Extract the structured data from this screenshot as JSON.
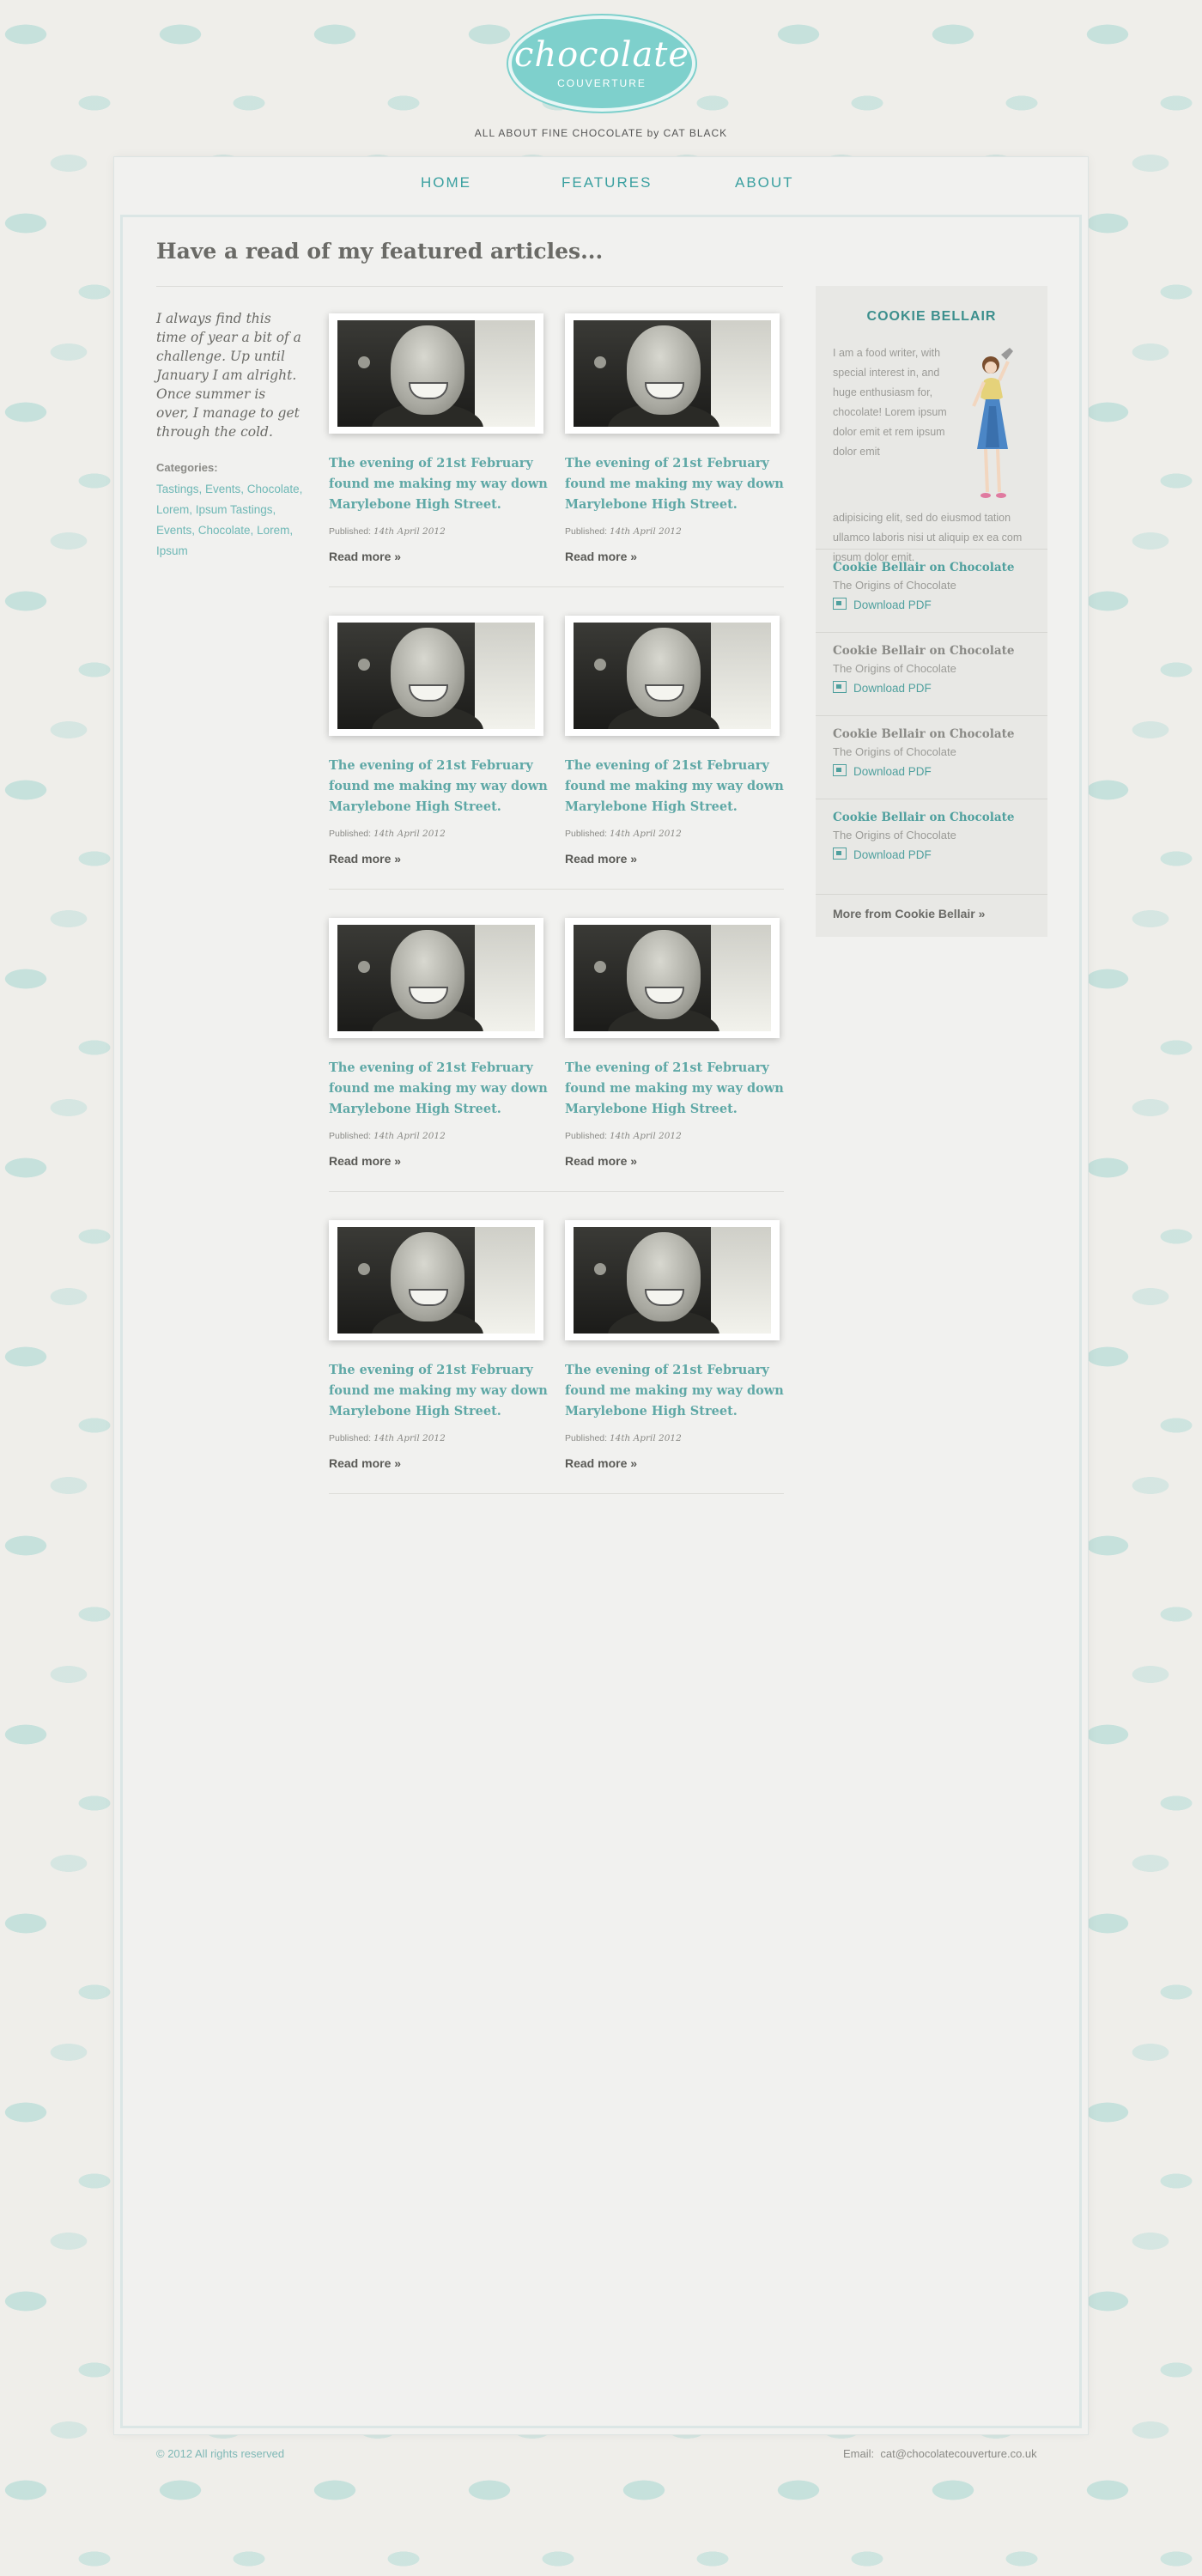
{
  "brand": {
    "logo_script": "chocolate",
    "logo_sub": "COUVERTURE",
    "tagline": "ALL ABOUT FINE CHOCOLATE by CAT BLACK"
  },
  "nav": [
    "HOME",
    "FEATURES",
    "ABOUT"
  ],
  "main": {
    "headline": "Have a read of my featured articles...",
    "intro": "I always find this time of year a bit of a challenge. Up until January I am alright. Once summer is over, I manage to get through the cold.",
    "categories_label": "Categories:",
    "categories": "Tastings, Events, Chocolate, Lorem, Ipsum Tastings, Events, Chocolate, Lorem, Ipsum",
    "articles": [
      {
        "title": "The evening of 21st February found me making my way down Marylebone High Street.",
        "published_label": "Published:",
        "date": "14th April 2012",
        "read_more": "Read more »"
      },
      {
        "title": "The evening of 21st February found me making my way down Marylebone High Street.",
        "published_label": "Published:",
        "date": "14th April 2012",
        "read_more": "Read more »"
      },
      {
        "title": "The evening of 21st February found me making my way down Marylebone High Street.",
        "published_label": "Published:",
        "date": "14th April 2012",
        "read_more": "Read more »"
      },
      {
        "title": "The evening of 21st February found me making my way down Marylebone High Street.",
        "published_label": "Published:",
        "date": "14th April 2012",
        "read_more": "Read more »"
      },
      {
        "title": "The evening of 21st February found me making my way down Marylebone High Street.",
        "published_label": "Published:",
        "date": "14th April 2012",
        "read_more": "Read more »"
      },
      {
        "title": "The evening of 21st February found me making my way down Marylebone High Street.",
        "published_label": "Published:",
        "date": "14th April 2012",
        "read_more": "Read more »"
      },
      {
        "title": "The evening of 21st February found me making my way down Marylebone High Street.",
        "published_label": "Published:",
        "date": "14th April 2012",
        "read_more": "Read more »"
      },
      {
        "title": "The evening of 21st February found me making my way down Marylebone High Street.",
        "published_label": "Published:",
        "date": "14th April 2012",
        "read_more": "Read more »"
      }
    ]
  },
  "sidebar": {
    "title": "COOKIE BELLAIR",
    "bio": "I am a food writer, with special interest in, and huge enthusiasm for, chocolate! Lorem ipsum dolor emit et rem ipsum dolor emit",
    "bio_cont": "adipisicing elit, sed do eiusmod tation ullamco laboris nisi ut aliquip ex ea com ipsum dolor emit.",
    "items": [
      {
        "title": "Cookie Bellair on Chocolate",
        "sub": "The Origins of Chocolate",
        "download": "Download PDF",
        "color": "#4fa09e"
      },
      {
        "title": "Cookie Bellair on Chocolate",
        "sub": "The Origins of Chocolate",
        "download": "Download PDF",
        "color": "#8a8a86"
      },
      {
        "title": "Cookie Bellair on Chocolate",
        "sub": "The Origins of Chocolate",
        "download": "Download PDF",
        "color": "#8a8a86"
      },
      {
        "title": "Cookie Bellair on Chocolate",
        "sub": "The Origins of Chocolate",
        "download": "Download PDF",
        "color": "#4fa09e"
      }
    ],
    "more": "More from Cookie Bellair »"
  },
  "footer": {
    "copyright": "© 2012 All rights reserved",
    "email_label": "Email:",
    "email": "cat@chocolatecouverture.co.uk"
  },
  "colors": {
    "accent": "#4fa09e",
    "logo": "#7ed0cc",
    "text": "#6a6a66"
  }
}
